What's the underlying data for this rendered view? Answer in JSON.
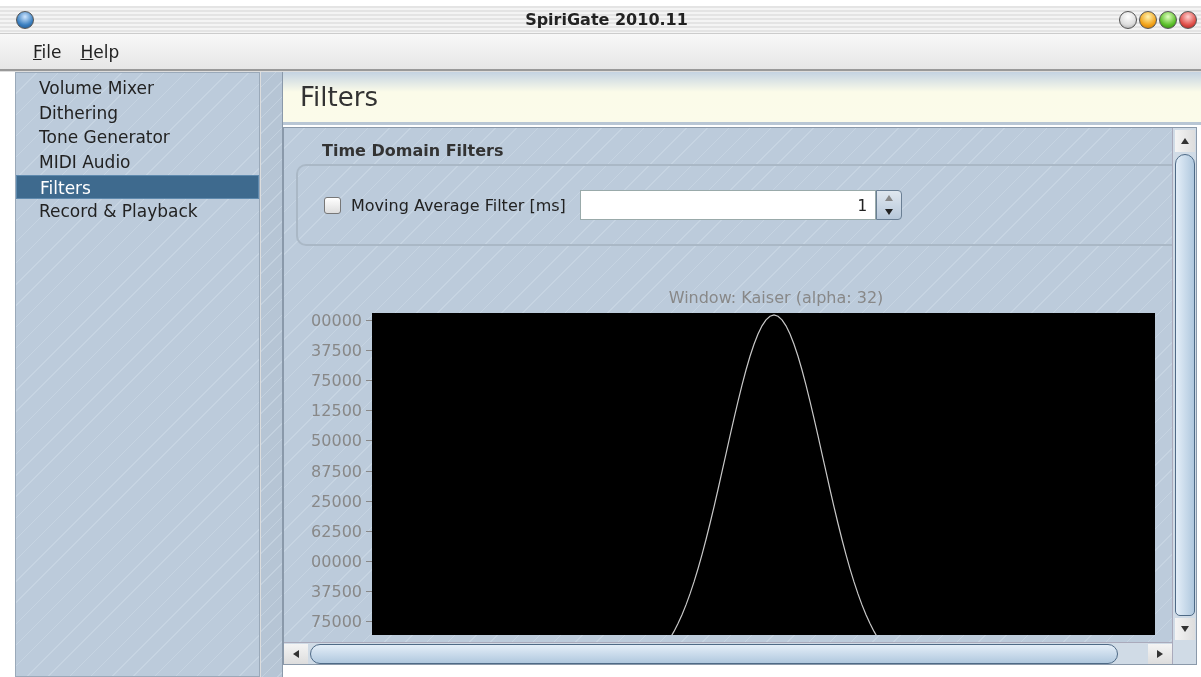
{
  "window": {
    "title": "SpiriGate 2010.11"
  },
  "menu": [
    "File",
    "Help"
  ],
  "sidebar": {
    "items": [
      {
        "label": "Volume Mixer",
        "selected": false
      },
      {
        "label": "Dithering",
        "selected": false
      },
      {
        "label": "Tone Generator",
        "selected": false
      },
      {
        "label": "MIDI Audio",
        "selected": false
      },
      {
        "label": "Filters",
        "selected": true
      },
      {
        "label": "Record & Playback",
        "selected": false
      }
    ]
  },
  "page": {
    "title": "Filters",
    "section": {
      "title": "Time Domain Filters",
      "checkbox": {
        "label": "Moving Average Filter [ms]",
        "checked": false
      },
      "spinner": {
        "value": "1"
      }
    },
    "chart": {
      "title": "Window: Kaiser (alpha: 32)",
      "y_tick_labels": [
        "00000",
        "37500",
        "75000",
        "12500",
        "50000",
        "87500",
        "25000",
        "62500",
        "00000",
        "37500",
        "75000"
      ]
    }
  }
}
